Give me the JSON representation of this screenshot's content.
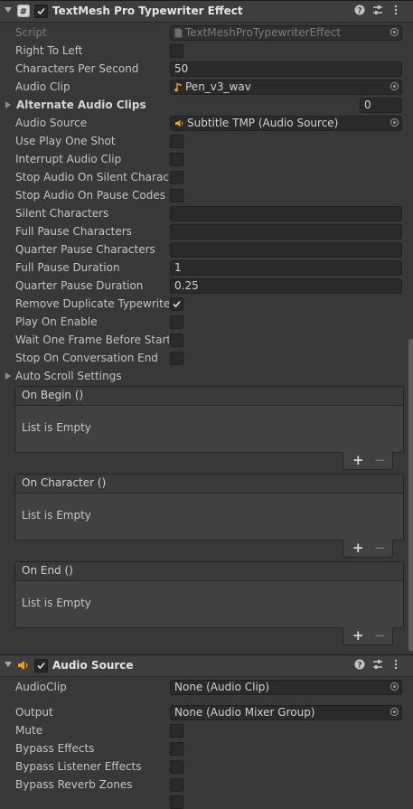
{
  "typewriter": {
    "title": "TextMesh Pro Typewriter Effect",
    "header_buttons": [
      "?",
      "⇄",
      "⋮"
    ],
    "script_label": "Script",
    "script_value": "TextMeshProTypewriterEffect",
    "right_to_left_label": "Right To Left",
    "cps_label": "Characters Per Second",
    "cps_value": "50",
    "audio_clip_label": "Audio Clip",
    "audio_clip_value": "Pen_v3_wav",
    "alt_clips_label": "Alternate Audio Clips",
    "alt_clips_count": "0",
    "audio_source_label": "Audio Source",
    "audio_source_value": "Subtitle TMP (Audio Source)",
    "use_play_one_shot_label": "Use Play One Shot",
    "interrupt_audio_clip_label": "Interrupt Audio Clip",
    "stop_audio_silent_label": "Stop Audio On Silent Characte",
    "stop_audio_pause_label": "Stop Audio On Pause Codes",
    "silent_chars_label": "Silent Characters",
    "silent_chars_value": "",
    "full_pause_chars_label": "Full Pause Characters",
    "full_pause_chars_value": "",
    "quarter_pause_chars_label": "Quarter Pause Characters",
    "quarter_pause_chars_value": "",
    "full_pause_duration_label": "Full Pause Duration",
    "full_pause_duration_value": "1",
    "quarter_pause_duration_label": "Quarter Pause Duration",
    "quarter_pause_duration_value": "0.25",
    "remove_duplicate_label": "Remove Duplicate Typewriter",
    "remove_duplicate_checked": true,
    "play_on_enable_label": "Play On Enable",
    "wait_one_frame_label": "Wait One Frame Before Startin",
    "stop_on_conversation_end_label": "Stop On Conversation End",
    "auto_scroll_label": "Auto Scroll Settings",
    "events": [
      {
        "title": "On Begin ()",
        "empty": "List is Empty"
      },
      {
        "title": "On Character ()",
        "empty": "List is Empty"
      },
      {
        "title": "On End ()",
        "empty": "List is Empty"
      }
    ],
    "plus": "+",
    "minus": "−"
  },
  "audio_source": {
    "title": "Audio Source",
    "audioclip_label": "AudioClip",
    "audioclip_value": "None (Audio Clip)",
    "output_label": "Output",
    "output_value": "None (Audio Mixer Group)",
    "mute_label": "Mute",
    "bypass_effects_label": "Bypass Effects",
    "bypass_listener_label": "Bypass Listener Effects",
    "bypass_reverb_label": "Bypass Reverb Zones"
  },
  "colors": {
    "background": "#383838",
    "header": "#3e3e3e",
    "field": "#2a2a2a",
    "audio_icon": "#e8a317"
  },
  "icons": [
    "script-component-icon",
    "script-asset-icon",
    "audio-clip-icon",
    "audio-source-icon",
    "object-picker-icon",
    "help-icon",
    "preset-icon",
    "context-menu-icon",
    "checkmark-icon"
  ]
}
